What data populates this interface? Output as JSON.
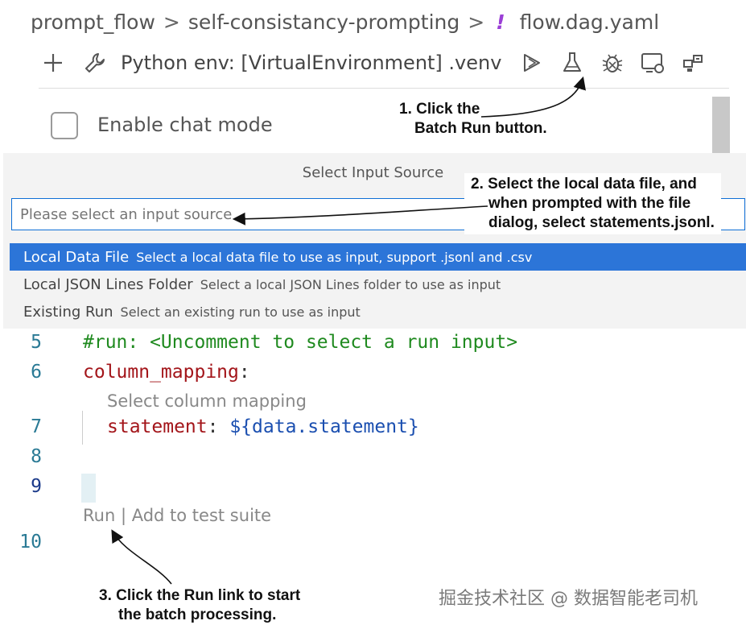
{
  "breadcrumb": {
    "items": [
      "prompt_flow",
      "self-consistancy-prompting",
      "flow.dag.yaml"
    ],
    "separator": ">",
    "file_icon": "!"
  },
  "toolbar": {
    "env_label": "Python env: [VirtualEnvironment] .venv",
    "icons": [
      "add-icon",
      "wrench-icon",
      "run-icon",
      "flask-icon",
      "bug-icon",
      "screen-icon",
      "layout-icon"
    ]
  },
  "chat_mode": {
    "label": "Enable chat mode",
    "checked": false
  },
  "quick_pick": {
    "title": "Select Input Source",
    "placeholder": "Please select an input source",
    "options": [
      {
        "label": "Local Data File",
        "description": "Select a local data file to use as input, support .jsonl and .csv",
        "selected": true
      },
      {
        "label": "Local JSON Lines Folder",
        "description": "Select a local JSON Lines folder to use as input",
        "selected": false
      },
      {
        "label": "Existing Run",
        "description": "Select an existing run to use as input",
        "selected": false
      }
    ]
  },
  "code": {
    "line5_num": "5",
    "line5": "#run: <Uncomment to select a run input>",
    "line6_num": "6",
    "line6_key": "column_mapping",
    "line6_colon": ":",
    "hint": "Select column mapping",
    "line7_num": "7",
    "line7_key": "statement",
    "line7_colon": ": ",
    "line7_val": "${data.statement}",
    "line8_num": "8",
    "line9_num": "9",
    "line10_num": "10",
    "codelens_run": "Run",
    "codelens_sep": " | ",
    "codelens_add": "Add to test suite"
  },
  "annotations": {
    "a1_line1": "1. Click the",
    "a1_line2": "Batch Run button.",
    "a2_line1": "2. Select the local data file, and",
    "a2_line2": "when prompted with the file",
    "a2_line3": "dialog, select statements.jsonl.",
    "a3_line1": "3. Click the Run link to start",
    "a3_line2": "the batch processing."
  },
  "watermark": "掘金技术社区 @ 数据智能老司机",
  "colors": {
    "accent": "#2c75d8",
    "comment": "#1f8a1f",
    "key": "#a3151a",
    "value": "#1b4fb0",
    "file_icon": "#9b3fd6"
  }
}
